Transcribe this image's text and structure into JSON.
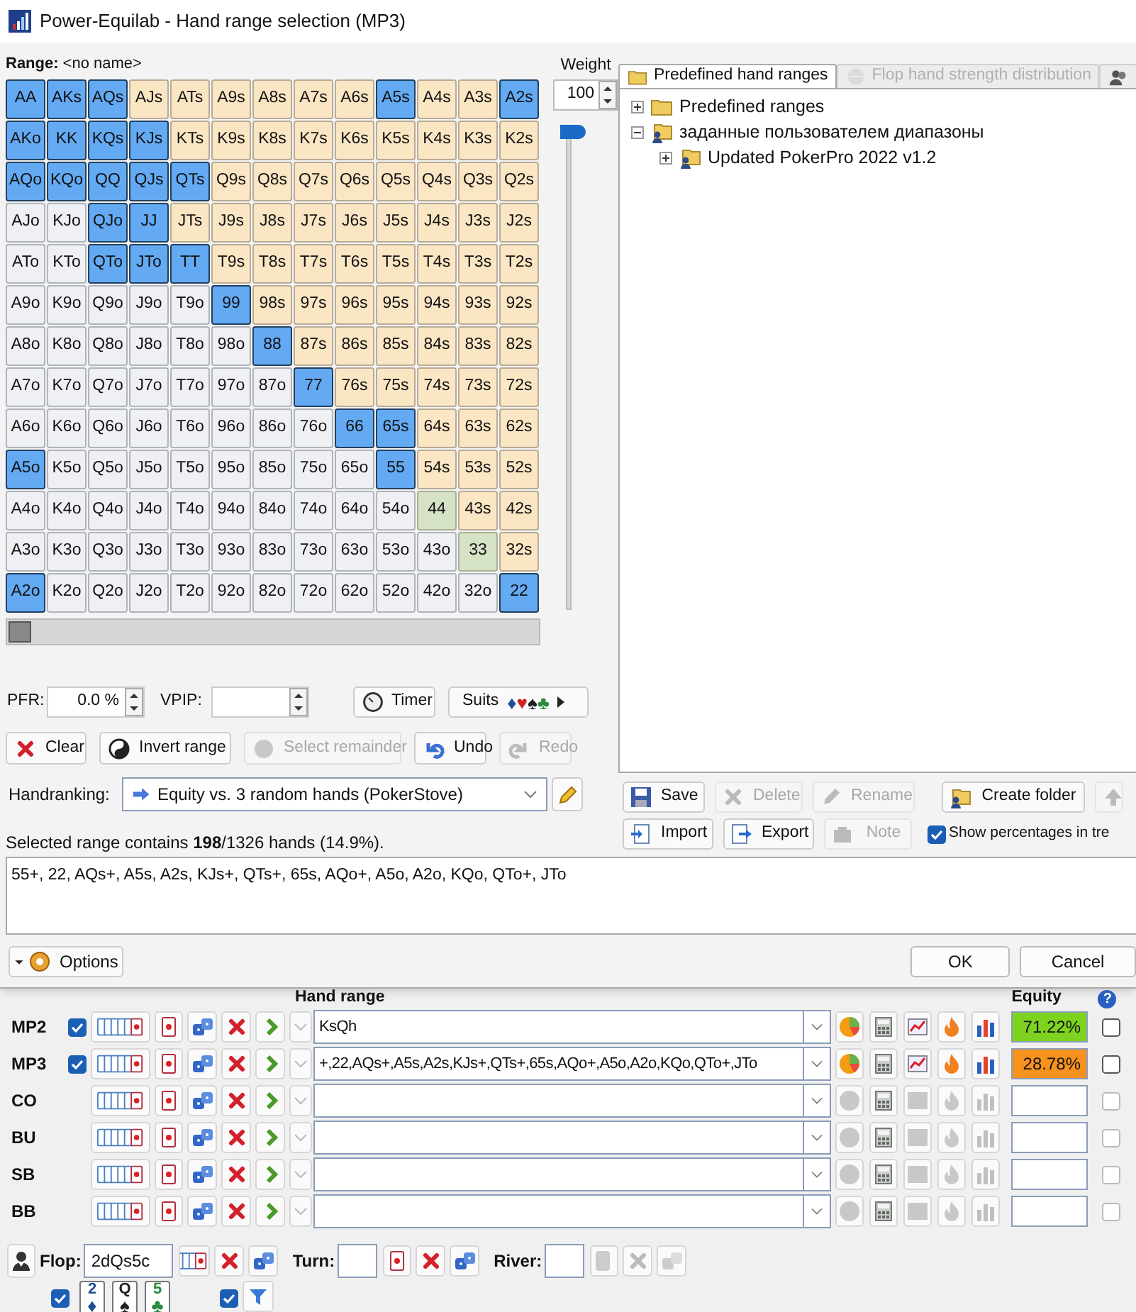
{
  "window": {
    "title": "Power-Equilab - Hand range selection (MP3)"
  },
  "range": {
    "label": "Range:",
    "name": "<no name>"
  },
  "weight": {
    "label": "Weight",
    "value": "100",
    "level": 1
  },
  "grid_slider": {
    "level": 0
  },
  "grid": [
    [
      {
        "label": "AA",
        "kind": "pair",
        "selected": true
      },
      {
        "label": "AKs",
        "kind": "suited",
        "selected": true
      },
      {
        "label": "AQs",
        "kind": "suited",
        "selected": true
      },
      {
        "label": "AJs",
        "kind": "suited",
        "selected": false
      },
      {
        "label": "ATs",
        "kind": "suited",
        "selected": false
      },
      {
        "label": "A9s",
        "kind": "suited",
        "selected": false
      },
      {
        "label": "A8s",
        "kind": "suited",
        "selected": false
      },
      {
        "label": "A7s",
        "kind": "suited",
        "selected": false
      },
      {
        "label": "A6s",
        "kind": "suited",
        "selected": false
      },
      {
        "label": "A5s",
        "kind": "suited",
        "selected": true
      },
      {
        "label": "A4s",
        "kind": "suited",
        "selected": false
      },
      {
        "label": "A3s",
        "kind": "suited",
        "selected": false
      },
      {
        "label": "A2s",
        "kind": "suited",
        "selected": true
      }
    ],
    [
      {
        "label": "AKo",
        "kind": "offsuit",
        "selected": true
      },
      {
        "label": "KK",
        "kind": "pair",
        "selected": true
      },
      {
        "label": "KQs",
        "kind": "suited",
        "selected": true
      },
      {
        "label": "KJs",
        "kind": "suited",
        "selected": true
      },
      {
        "label": "KTs",
        "kind": "suited",
        "selected": false
      },
      {
        "label": "K9s",
        "kind": "suited",
        "selected": false
      },
      {
        "label": "K8s",
        "kind": "suited",
        "selected": false
      },
      {
        "label": "K7s",
        "kind": "suited",
        "selected": false
      },
      {
        "label": "K6s",
        "kind": "suited",
        "selected": false
      },
      {
        "label": "K5s",
        "kind": "suited",
        "selected": false
      },
      {
        "label": "K4s",
        "kind": "suited",
        "selected": false
      },
      {
        "label": "K3s",
        "kind": "suited",
        "selected": false
      },
      {
        "label": "K2s",
        "kind": "suited",
        "selected": false
      }
    ],
    [
      {
        "label": "AQo",
        "kind": "offsuit",
        "selected": true
      },
      {
        "label": "KQo",
        "kind": "offsuit",
        "selected": true
      },
      {
        "label": "QQ",
        "kind": "pair",
        "selected": true
      },
      {
        "label": "QJs",
        "kind": "suited",
        "selected": true
      },
      {
        "label": "QTs",
        "kind": "suited",
        "selected": true
      },
      {
        "label": "Q9s",
        "kind": "suited",
        "selected": false
      },
      {
        "label": "Q8s",
        "kind": "suited",
        "selected": false
      },
      {
        "label": "Q7s",
        "kind": "suited",
        "selected": false
      },
      {
        "label": "Q6s",
        "kind": "suited",
        "selected": false
      },
      {
        "label": "Q5s",
        "kind": "suited",
        "selected": false
      },
      {
        "label": "Q4s",
        "kind": "suited",
        "selected": false
      },
      {
        "label": "Q3s",
        "kind": "suited",
        "selected": false
      },
      {
        "label": "Q2s",
        "kind": "suited",
        "selected": false
      }
    ],
    [
      {
        "label": "AJo",
        "kind": "offsuit",
        "selected": false
      },
      {
        "label": "KJo",
        "kind": "offsuit",
        "selected": false
      },
      {
        "label": "QJo",
        "kind": "offsuit",
        "selected": true
      },
      {
        "label": "JJ",
        "kind": "pair",
        "selected": true
      },
      {
        "label": "JTs",
        "kind": "suited",
        "selected": false
      },
      {
        "label": "J9s",
        "kind": "suited",
        "selected": false
      },
      {
        "label": "J8s",
        "kind": "suited",
        "selected": false
      },
      {
        "label": "J7s",
        "kind": "suited",
        "selected": false
      },
      {
        "label": "J6s",
        "kind": "suited",
        "selected": false
      },
      {
        "label": "J5s",
        "kind": "suited",
        "selected": false
      },
      {
        "label": "J4s",
        "kind": "suited",
        "selected": false
      },
      {
        "label": "J3s",
        "kind": "suited",
        "selected": false
      },
      {
        "label": "J2s",
        "kind": "suited",
        "selected": false
      }
    ],
    [
      {
        "label": "ATo",
        "kind": "offsuit",
        "selected": false
      },
      {
        "label": "KTo",
        "kind": "offsuit",
        "selected": false
      },
      {
        "label": "QTo",
        "kind": "offsuit",
        "selected": true
      },
      {
        "label": "JTo",
        "kind": "offsuit",
        "selected": true
      },
      {
        "label": "TT",
        "kind": "pair",
        "selected": true
      },
      {
        "label": "T9s",
        "kind": "suited",
        "selected": false
      },
      {
        "label": "T8s",
        "kind": "suited",
        "selected": false
      },
      {
        "label": "T7s",
        "kind": "suited",
        "selected": false
      },
      {
        "label": "T6s",
        "kind": "suited",
        "selected": false
      },
      {
        "label": "T5s",
        "kind": "suited",
        "selected": false
      },
      {
        "label": "T4s",
        "kind": "suited",
        "selected": false
      },
      {
        "label": "T3s",
        "kind": "suited",
        "selected": false
      },
      {
        "label": "T2s",
        "kind": "suited",
        "selected": false
      }
    ],
    [
      {
        "label": "A9o",
        "kind": "offsuit",
        "selected": false
      },
      {
        "label": "K9o",
        "kind": "offsuit",
        "selected": false
      },
      {
        "label": "Q9o",
        "kind": "offsuit",
        "selected": false
      },
      {
        "label": "J9o",
        "kind": "offsuit",
        "selected": false
      },
      {
        "label": "T9o",
        "kind": "offsuit",
        "selected": false
      },
      {
        "label": "99",
        "kind": "pair",
        "selected": true
      },
      {
        "label": "98s",
        "kind": "suited",
        "selected": false
      },
      {
        "label": "97s",
        "kind": "suited",
        "selected": false
      },
      {
        "label": "96s",
        "kind": "suited",
        "selected": false
      },
      {
        "label": "95s",
        "kind": "suited",
        "selected": false
      },
      {
        "label": "94s",
        "kind": "suited",
        "selected": false
      },
      {
        "label": "93s",
        "kind": "suited",
        "selected": false
      },
      {
        "label": "92s",
        "kind": "suited",
        "selected": false
      }
    ],
    [
      {
        "label": "A8o",
        "kind": "offsuit",
        "selected": false
      },
      {
        "label": "K8o",
        "kind": "offsuit",
        "selected": false
      },
      {
        "label": "Q8o",
        "kind": "offsuit",
        "selected": false
      },
      {
        "label": "J8o",
        "kind": "offsuit",
        "selected": false
      },
      {
        "label": "T8o",
        "kind": "offsuit",
        "selected": false
      },
      {
        "label": "98o",
        "kind": "offsuit",
        "selected": false
      },
      {
        "label": "88",
        "kind": "pair",
        "selected": true
      },
      {
        "label": "87s",
        "kind": "suited",
        "selected": false
      },
      {
        "label": "86s",
        "kind": "suited",
        "selected": false
      },
      {
        "label": "85s",
        "kind": "suited",
        "selected": false
      },
      {
        "label": "84s",
        "kind": "suited",
        "selected": false
      },
      {
        "label": "83s",
        "kind": "suited",
        "selected": false
      },
      {
        "label": "82s",
        "kind": "suited",
        "selected": false
      }
    ],
    [
      {
        "label": "A7o",
        "kind": "offsuit",
        "selected": false
      },
      {
        "label": "K7o",
        "kind": "offsuit",
        "selected": false
      },
      {
        "label": "Q7o",
        "kind": "offsuit",
        "selected": false
      },
      {
        "label": "J7o",
        "kind": "offsuit",
        "selected": false
      },
      {
        "label": "T7o",
        "kind": "offsuit",
        "selected": false
      },
      {
        "label": "97o",
        "kind": "offsuit",
        "selected": false
      },
      {
        "label": "87o",
        "kind": "offsuit",
        "selected": false
      },
      {
        "label": "77",
        "kind": "pair",
        "selected": true
      },
      {
        "label": "76s",
        "kind": "suited",
        "selected": false
      },
      {
        "label": "75s",
        "kind": "suited",
        "selected": false
      },
      {
        "label": "74s",
        "kind": "suited",
        "selected": false
      },
      {
        "label": "73s",
        "kind": "suited",
        "selected": false
      },
      {
        "label": "72s",
        "kind": "suited",
        "selected": false
      }
    ],
    [
      {
        "label": "A6o",
        "kind": "offsuit",
        "selected": false
      },
      {
        "label": "K6o",
        "kind": "offsuit",
        "selected": false
      },
      {
        "label": "Q6o",
        "kind": "offsuit",
        "selected": false
      },
      {
        "label": "J6o",
        "kind": "offsuit",
        "selected": false
      },
      {
        "label": "T6o",
        "kind": "offsuit",
        "selected": false
      },
      {
        "label": "96o",
        "kind": "offsuit",
        "selected": false
      },
      {
        "label": "86o",
        "kind": "offsuit",
        "selected": false
      },
      {
        "label": "76o",
        "kind": "offsuit",
        "selected": false
      },
      {
        "label": "66",
        "kind": "pair",
        "selected": true
      },
      {
        "label": "65s",
        "kind": "suited",
        "selected": true
      },
      {
        "label": "64s",
        "kind": "suited",
        "selected": false
      },
      {
        "label": "63s",
        "kind": "suited",
        "selected": false
      },
      {
        "label": "62s",
        "kind": "suited",
        "selected": false
      }
    ],
    [
      {
        "label": "A5o",
        "kind": "offsuit",
        "selected": true
      },
      {
        "label": "K5o",
        "kind": "offsuit",
        "selected": false
      },
      {
        "label": "Q5o",
        "kind": "offsuit",
        "selected": false
      },
      {
        "label": "J5o",
        "kind": "offsuit",
        "selected": false
      },
      {
        "label": "T5o",
        "kind": "offsuit",
        "selected": false
      },
      {
        "label": "95o",
        "kind": "offsuit",
        "selected": false
      },
      {
        "label": "85o",
        "kind": "offsuit",
        "selected": false
      },
      {
        "label": "75o",
        "kind": "offsuit",
        "selected": false
      },
      {
        "label": "65o",
        "kind": "offsuit",
        "selected": false
      },
      {
        "label": "55",
        "kind": "pair",
        "selected": true
      },
      {
        "label": "54s",
        "kind": "suited",
        "selected": false
      },
      {
        "label": "53s",
        "kind": "suited",
        "selected": false
      },
      {
        "label": "52s",
        "kind": "suited",
        "selected": false
      }
    ],
    [
      {
        "label": "A4o",
        "kind": "offsuit",
        "selected": false
      },
      {
        "label": "K4o",
        "kind": "offsuit",
        "selected": false
      },
      {
        "label": "Q4o",
        "kind": "offsuit",
        "selected": false
      },
      {
        "label": "J4o",
        "kind": "offsuit",
        "selected": false
      },
      {
        "label": "T4o",
        "kind": "offsuit",
        "selected": false
      },
      {
        "label": "94o",
        "kind": "offsuit",
        "selected": false
      },
      {
        "label": "84o",
        "kind": "offsuit",
        "selected": false
      },
      {
        "label": "74o",
        "kind": "offsuit",
        "selected": false
      },
      {
        "label": "64o",
        "kind": "offsuit",
        "selected": false
      },
      {
        "label": "54o",
        "kind": "offsuit",
        "selected": false
      },
      {
        "label": "44",
        "kind": "pair",
        "selected": false
      },
      {
        "label": "43s",
        "kind": "suited",
        "selected": false
      },
      {
        "label": "42s",
        "kind": "suited",
        "selected": false
      }
    ],
    [
      {
        "label": "A3o",
        "kind": "offsuit",
        "selected": false
      },
      {
        "label": "K3o",
        "kind": "offsuit",
        "selected": false
      },
      {
        "label": "Q3o",
        "kind": "offsuit",
        "selected": false
      },
      {
        "label": "J3o",
        "kind": "offsuit",
        "selected": false
      },
      {
        "label": "T3o",
        "kind": "offsuit",
        "selected": false
      },
      {
        "label": "93o",
        "kind": "offsuit",
        "selected": false
      },
      {
        "label": "83o",
        "kind": "offsuit",
        "selected": false
      },
      {
        "label": "73o",
        "kind": "offsuit",
        "selected": false
      },
      {
        "label": "63o",
        "kind": "offsuit",
        "selected": false
      },
      {
        "label": "53o",
        "kind": "offsuit",
        "selected": false
      },
      {
        "label": "43o",
        "kind": "offsuit",
        "selected": false
      },
      {
        "label": "33",
        "kind": "pair",
        "selected": false
      },
      {
        "label": "32s",
        "kind": "suited",
        "selected": false
      }
    ],
    [
      {
        "label": "A2o",
        "kind": "offsuit",
        "selected": true
      },
      {
        "label": "K2o",
        "kind": "offsuit",
        "selected": false
      },
      {
        "label": "Q2o",
        "kind": "offsuit",
        "selected": false
      },
      {
        "label": "J2o",
        "kind": "offsuit",
        "selected": false
      },
      {
        "label": "T2o",
        "kind": "offsuit",
        "selected": false
      },
      {
        "label": "92o",
        "kind": "offsuit",
        "selected": false
      },
      {
        "label": "82o",
        "kind": "offsuit",
        "selected": false
      },
      {
        "label": "72o",
        "kind": "offsuit",
        "selected": false
      },
      {
        "label": "62o",
        "kind": "offsuit",
        "selected": false
      },
      {
        "label": "52o",
        "kind": "offsuit",
        "selected": false
      },
      {
        "label": "42o",
        "kind": "offsuit",
        "selected": false
      },
      {
        "label": "32o",
        "kind": "offsuit",
        "selected": false
      },
      {
        "label": "22",
        "kind": "pair",
        "selected": true
      }
    ]
  ],
  "stats": {
    "pfr_label": "PFR:",
    "pfr_value": "0.0 %",
    "vpip_label": "VPIP:",
    "timer": "Timer",
    "suits_label": "Suits",
    "suits": [
      {
        "glyph": "♦",
        "color": "#1f4e96"
      },
      {
        "glyph": "♥",
        "color": "#d0202a"
      },
      {
        "glyph": "♠",
        "color": "#202020"
      },
      {
        "glyph": "♣",
        "color": "#2a8a3a"
      }
    ]
  },
  "actions": [
    {
      "label": "Clear",
      "kind": "clear",
      "disabled": false
    },
    {
      "label": "Invert range",
      "kind": "invert",
      "disabled": false
    },
    {
      "label": "Select remainder",
      "kind": "remainder",
      "disabled": true
    },
    {
      "label": "Undo",
      "kind": "undo",
      "disabled": false
    },
    {
      "label": "Redo",
      "kind": "redo",
      "disabled": true
    }
  ],
  "handranking": {
    "label": "Handranking:",
    "value": "Equity vs. 3 random hands (PokerStove)"
  },
  "summary": "Selected range contains **198**/1326 hands (14.9%).",
  "range_text": "55+, 22, AQs+, A5s, A2s, KJs+, QTs+, 65s, AQo+, A5o, A2o, KQo, QTo+, JTo",
  "tabs": [
    {
      "label": "Predefined hand ranges",
      "kind": "folder",
      "selected": true,
      "disabled": false
    },
    {
      "label": "Flop hand strength distribution",
      "kind": "sphere",
      "selected": false,
      "disabled": true
    },
    {
      "kind": "people",
      "selected": false,
      "disabled": false
    }
  ],
  "tree": [
    {
      "label": "Predefined ranges",
      "kind": "folder",
      "expanded": false
    },
    {
      "label": "заданные пользователем диапазоны",
      "kind": "user_folder",
      "expanded": true,
      "children": [
        {
          "label": "Updated PokerPro 2022 v1.2",
          "kind": "user_folder",
          "expanded": false
        }
      ]
    }
  ],
  "tree_buttons": [
    {
      "label": "Save",
      "kind": "save",
      "disabled": false
    },
    {
      "label": "Delete",
      "kind": "delete",
      "disabled": true
    },
    {
      "label": "Rename",
      "kind": "rename",
      "disabled": true
    },
    {
      "label": "Create folder",
      "kind": "folder",
      "disabled": false
    },
    {
      "kind": "up",
      "disabled": true
    },
    {
      "label": "Import",
      "kind": "import",
      "disabled": false
    },
    {
      "label": "Export",
      "kind": "export",
      "disabled": false
    },
    {
      "label": "Note",
      "kind": "note",
      "disabled": true
    }
  ],
  "show_percentages": {
    "label": "Show percentages in tre",
    "checked": true
  },
  "footer": {
    "options": "Options",
    "ok": "OK",
    "cancel": "Cancel"
  },
  "table": {
    "range_header": "Hand range",
    "equity_header": "Equity",
    "help": "?"
  },
  "players": [
    {
      "name": "MP2",
      "active": true,
      "checked": false,
      "range": "KsQh",
      "equity": "71.22%",
      "color": "#7dd320"
    },
    {
      "name": "MP3",
      "active": true,
      "checked": false,
      "range": "+,22,AQs+,A5s,A2s,KJs+,QTs+,65s,AQo+,A5o,A2o,KQo,QTo+,JTo",
      "equity": "28.78%",
      "color": "#f7921e"
    },
    {
      "name": "CO",
      "active": false,
      "checked": false
    },
    {
      "name": "BU",
      "active": false,
      "checked": false
    },
    {
      "name": "SB",
      "active": false,
      "checked": false
    },
    {
      "name": "BB",
      "active": false,
      "checked": false
    }
  ],
  "board": [
    {
      "label": "Flop:",
      "value": "2dQs5c",
      "enabled": true
    },
    {
      "label": "Turn:",
      "enabled": true
    },
    {
      "label": "River:",
      "enabled": false
    }
  ],
  "board_filter": {
    "checked": true
  },
  "board_cards_checked": true,
  "board_cards": [
    {
      "rank": "2",
      "suit": "♦",
      "color": "#1f4e96"
    },
    {
      "rank": "Q",
      "suit": "♠",
      "color": "#202020"
    },
    {
      "rank": "5",
      "suit": "♣",
      "color": "#2a8a3a"
    }
  ]
}
